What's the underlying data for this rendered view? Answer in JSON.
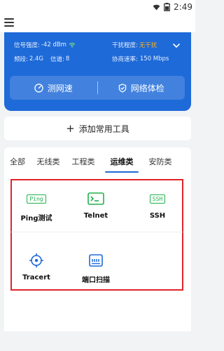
{
  "status_bar": {
    "time": "2:49"
  },
  "info": {
    "signal_label": "信号强度:",
    "signal_value": "-42 dBm",
    "interference_label": "干扰程度:",
    "interference_value": "无干扰",
    "band_label": "频段:",
    "band_value": "2.4G",
    "channel_label": "信道:",
    "channel_value": "8",
    "rate_label": "协商速率:",
    "rate_value": "150 Mbps"
  },
  "actions": {
    "speed_test": "测网速",
    "network_check": "网络体检"
  },
  "add_tool": {
    "label": "添加常用工具"
  },
  "tabs": [
    "全部",
    "无线类",
    "工程类",
    "运维类",
    "安防类"
  ],
  "active_tab": "运维类",
  "tools": [
    {
      "label": "Ping测试",
      "icon": "ping-icon",
      "icon_text": "Ping"
    },
    {
      "label": "Telnet",
      "icon": "terminal-icon"
    },
    {
      "label": "SSH",
      "icon": "ssh-icon",
      "icon_text": "SSH"
    },
    {
      "label": "Tracert",
      "icon": "target-icon"
    },
    {
      "label": "端口扫描",
      "icon": "port-scan-icon"
    }
  ],
  "colors": {
    "primary": "#1e6ad8",
    "accent_green": "#22b14c",
    "warning": "#ffb020",
    "highlight_border": "#e0242c"
  }
}
